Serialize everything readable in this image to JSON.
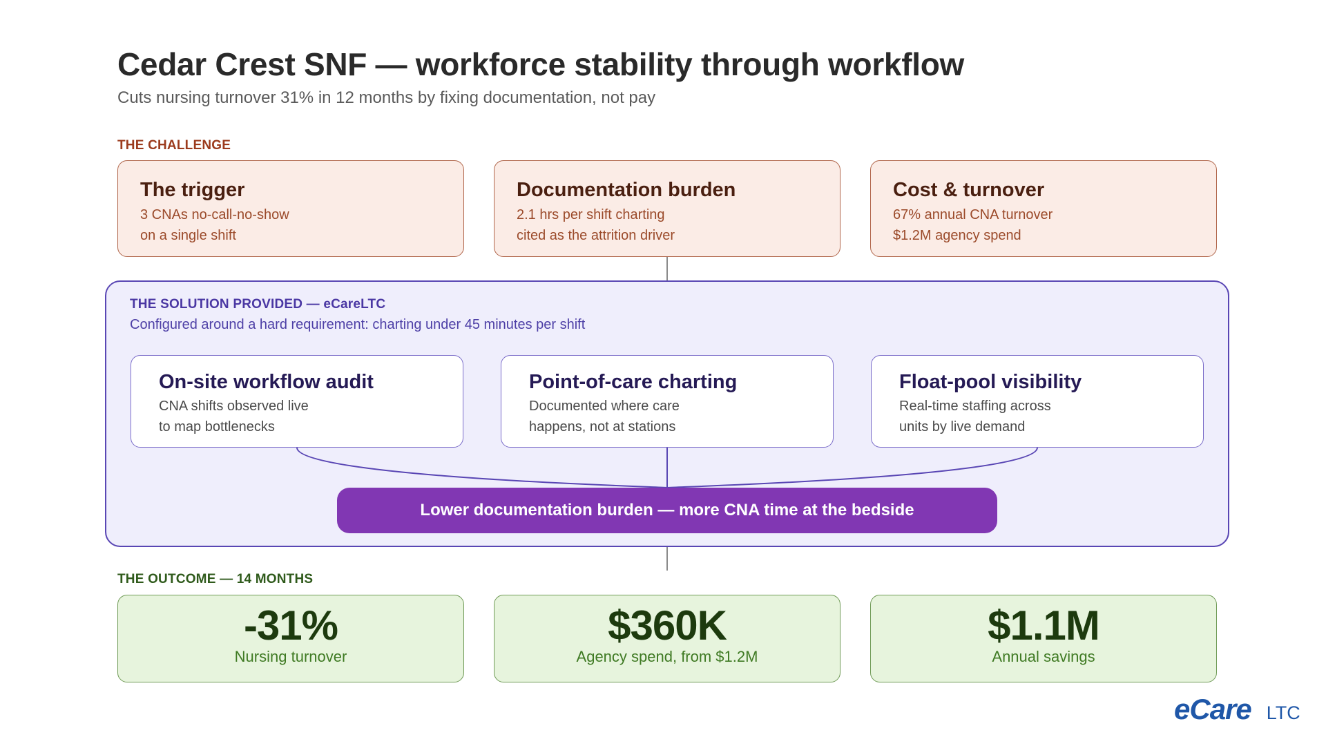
{
  "header": {
    "title": "Cedar Crest SNF — workforce stability through workflow",
    "subtitle": "Cuts nursing turnover 31% in 12 months by fixing documentation, not pay"
  },
  "challenge": {
    "label": "THE CHALLENGE",
    "cards": [
      {
        "title": "The trigger",
        "line1": "3 CNAs no-call-no-show",
        "line2": "on a single shift"
      },
      {
        "title": "Documentation burden",
        "line1": "2.1 hrs per shift charting",
        "line2": "cited as the attrition driver"
      },
      {
        "title": "Cost & turnover",
        "line1": "67% annual CNA turnover",
        "line2": "$1.2M agency spend"
      }
    ]
  },
  "solution": {
    "label": "THE SOLUTION PROVIDED — eCareLTC",
    "subtitle": "Configured around a hard requirement: charting under 45 minutes per shift",
    "steps": [
      {
        "title": "On-site workflow audit",
        "line1": "CNA shifts observed live",
        "line2": "to map bottlenecks"
      },
      {
        "title": "Point-of-care charting",
        "line1": "Documented where care",
        "line2": "happens, not at stations"
      },
      {
        "title": "Float-pool visibility",
        "line1": "Real-time staffing across",
        "line2": "units by live demand"
      }
    ],
    "result": "Lower documentation burden — more CNA time at the bedside"
  },
  "outcome": {
    "label": "THE OUTCOME — 14 MONTHS",
    "metrics": [
      {
        "value": "-31%",
        "label": "Nursing turnover"
      },
      {
        "value": "$360K",
        "label": "Agency spend, from $1.2M"
      },
      {
        "value": "$1.1M",
        "label": "Annual savings"
      }
    ]
  },
  "logo": {
    "main": "eCare",
    "sub": "LTC"
  },
  "colors": {
    "challenge_fill": "#fbece6",
    "challenge_border": "#b0654a",
    "solution_fill": "#efeefc",
    "solution_border": "#5946b4",
    "result_fill": "#8137b3",
    "outcome_fill": "#e7f4dd",
    "outcome_border": "#6f9a56",
    "brand_blue": "#1f57a8"
  }
}
